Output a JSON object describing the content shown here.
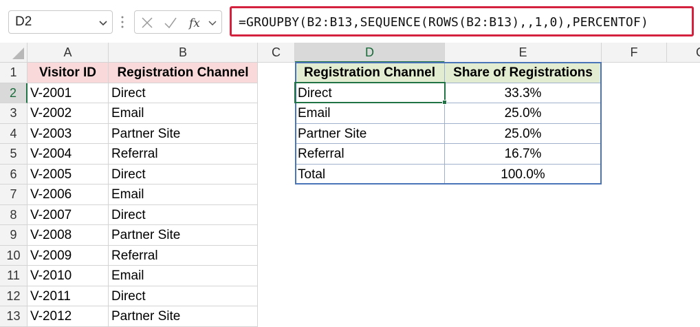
{
  "name_box": {
    "value": "D2"
  },
  "formula_bar": {
    "formula": "=GROUPBY(B2:B13,SEQUENCE(ROWS(B2:B13),,1,0),PERCENTOF)"
  },
  "columns": [
    "A",
    "B",
    "C",
    "D",
    "E",
    "F",
    "G"
  ],
  "rows": [
    "1",
    "2",
    "3",
    "4",
    "5",
    "6",
    "7",
    "8",
    "9",
    "10",
    "11",
    "12",
    "13"
  ],
  "selected_cell": "D2",
  "source_table": {
    "headers": [
      "Visitor ID",
      "Registration Channel"
    ],
    "rows": [
      [
        "V-2001",
        "Direct"
      ],
      [
        "V-2002",
        "Email"
      ],
      [
        "V-2003",
        "Partner Site"
      ],
      [
        "V-2004",
        "Referral"
      ],
      [
        "V-2005",
        "Direct"
      ],
      [
        "V-2006",
        "Email"
      ],
      [
        "V-2007",
        "Direct"
      ],
      [
        "V-2008",
        "Partner Site"
      ],
      [
        "V-2009",
        "Referral"
      ],
      [
        "V-2010",
        "Email"
      ],
      [
        "V-2011",
        "Direct"
      ],
      [
        "V-2012",
        "Partner Site"
      ]
    ]
  },
  "result_table": {
    "headers": [
      "Registration Channel",
      "Share of Registrations"
    ],
    "rows": [
      [
        "Direct",
        "33.3%"
      ],
      [
        "Email",
        "25.0%"
      ],
      [
        "Partner Site",
        "25.0%"
      ],
      [
        "Referral",
        "16.7%"
      ],
      [
        "Total",
        "100.0%"
      ]
    ]
  },
  "colors": {
    "formula_border": "#d4213d",
    "source_header_fill": "#f9d9d9",
    "result_header_fill": "#e2ecd0",
    "selection": "#217346",
    "spill_border": "#4a74b8"
  },
  "icons": [
    "chevron-down-icon",
    "cancel-icon",
    "enter-check-icon",
    "fx-icon"
  ]
}
